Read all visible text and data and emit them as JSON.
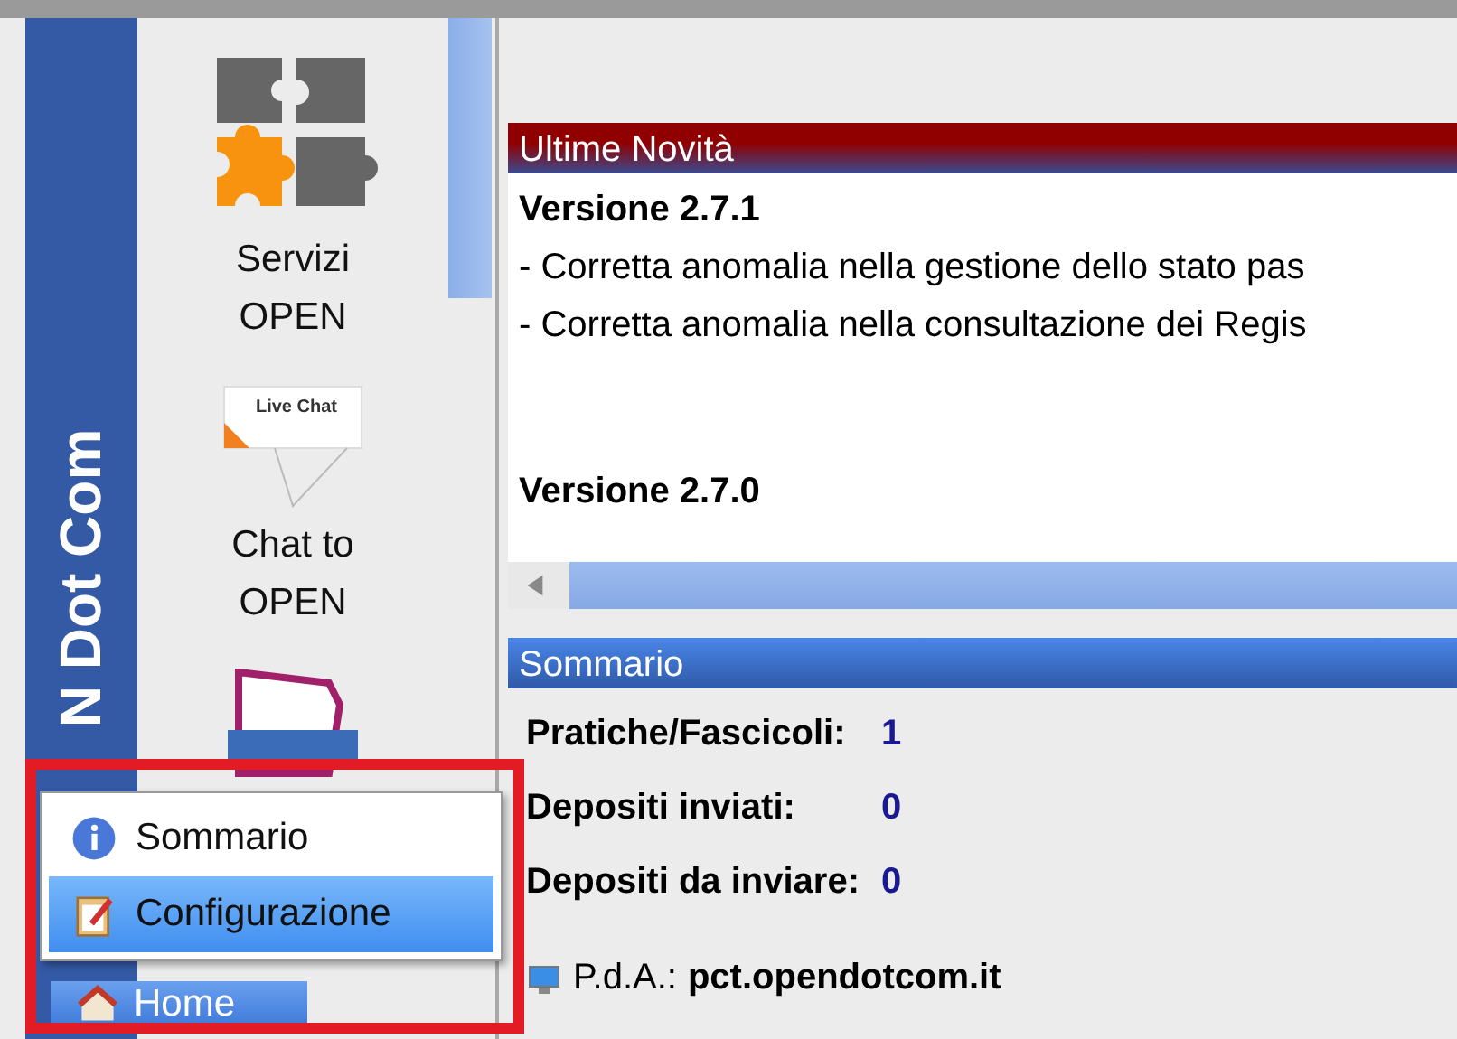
{
  "brand": {
    "text": "N Dot Com"
  },
  "sidebar": {
    "items": [
      {
        "kind": "puzzle",
        "label_lines": [
          "Servizi",
          "OPEN"
        ]
      },
      {
        "kind": "chat",
        "badge_text": "Live Chat",
        "label_lines": [
          "Chat to",
          "OPEN"
        ]
      },
      {
        "kind": "document"
      }
    ]
  },
  "news": {
    "title": "Ultime Novità",
    "entries": [
      {
        "version": "Versione 2.7.1",
        "changes": [
          "- Corretta anomalia nella gestione dello stato pas",
          "- Corretta anomalia nella consultazione dei Regis"
        ]
      },
      {
        "version": "Versione 2.7.0"
      }
    ]
  },
  "summary": {
    "title": "Sommario",
    "stats": [
      {
        "label": "Pratiche/Fascicoli:",
        "value": "1"
      },
      {
        "label": "Depositi inviati:",
        "value": "0"
      },
      {
        "label": "Depositi da inviare:",
        "value": "0"
      }
    ],
    "pda": {
      "label": "P.d.A.:",
      "value": "pct.opendotcom.it"
    }
  },
  "popup_menu": {
    "items": [
      {
        "kind": "info",
        "label": "Sommario",
        "selected": false
      },
      {
        "kind": "config",
        "label": "Configurazione",
        "selected": true
      }
    ]
  },
  "home_tab": {
    "label": "Home",
    "selected": true
  }
}
